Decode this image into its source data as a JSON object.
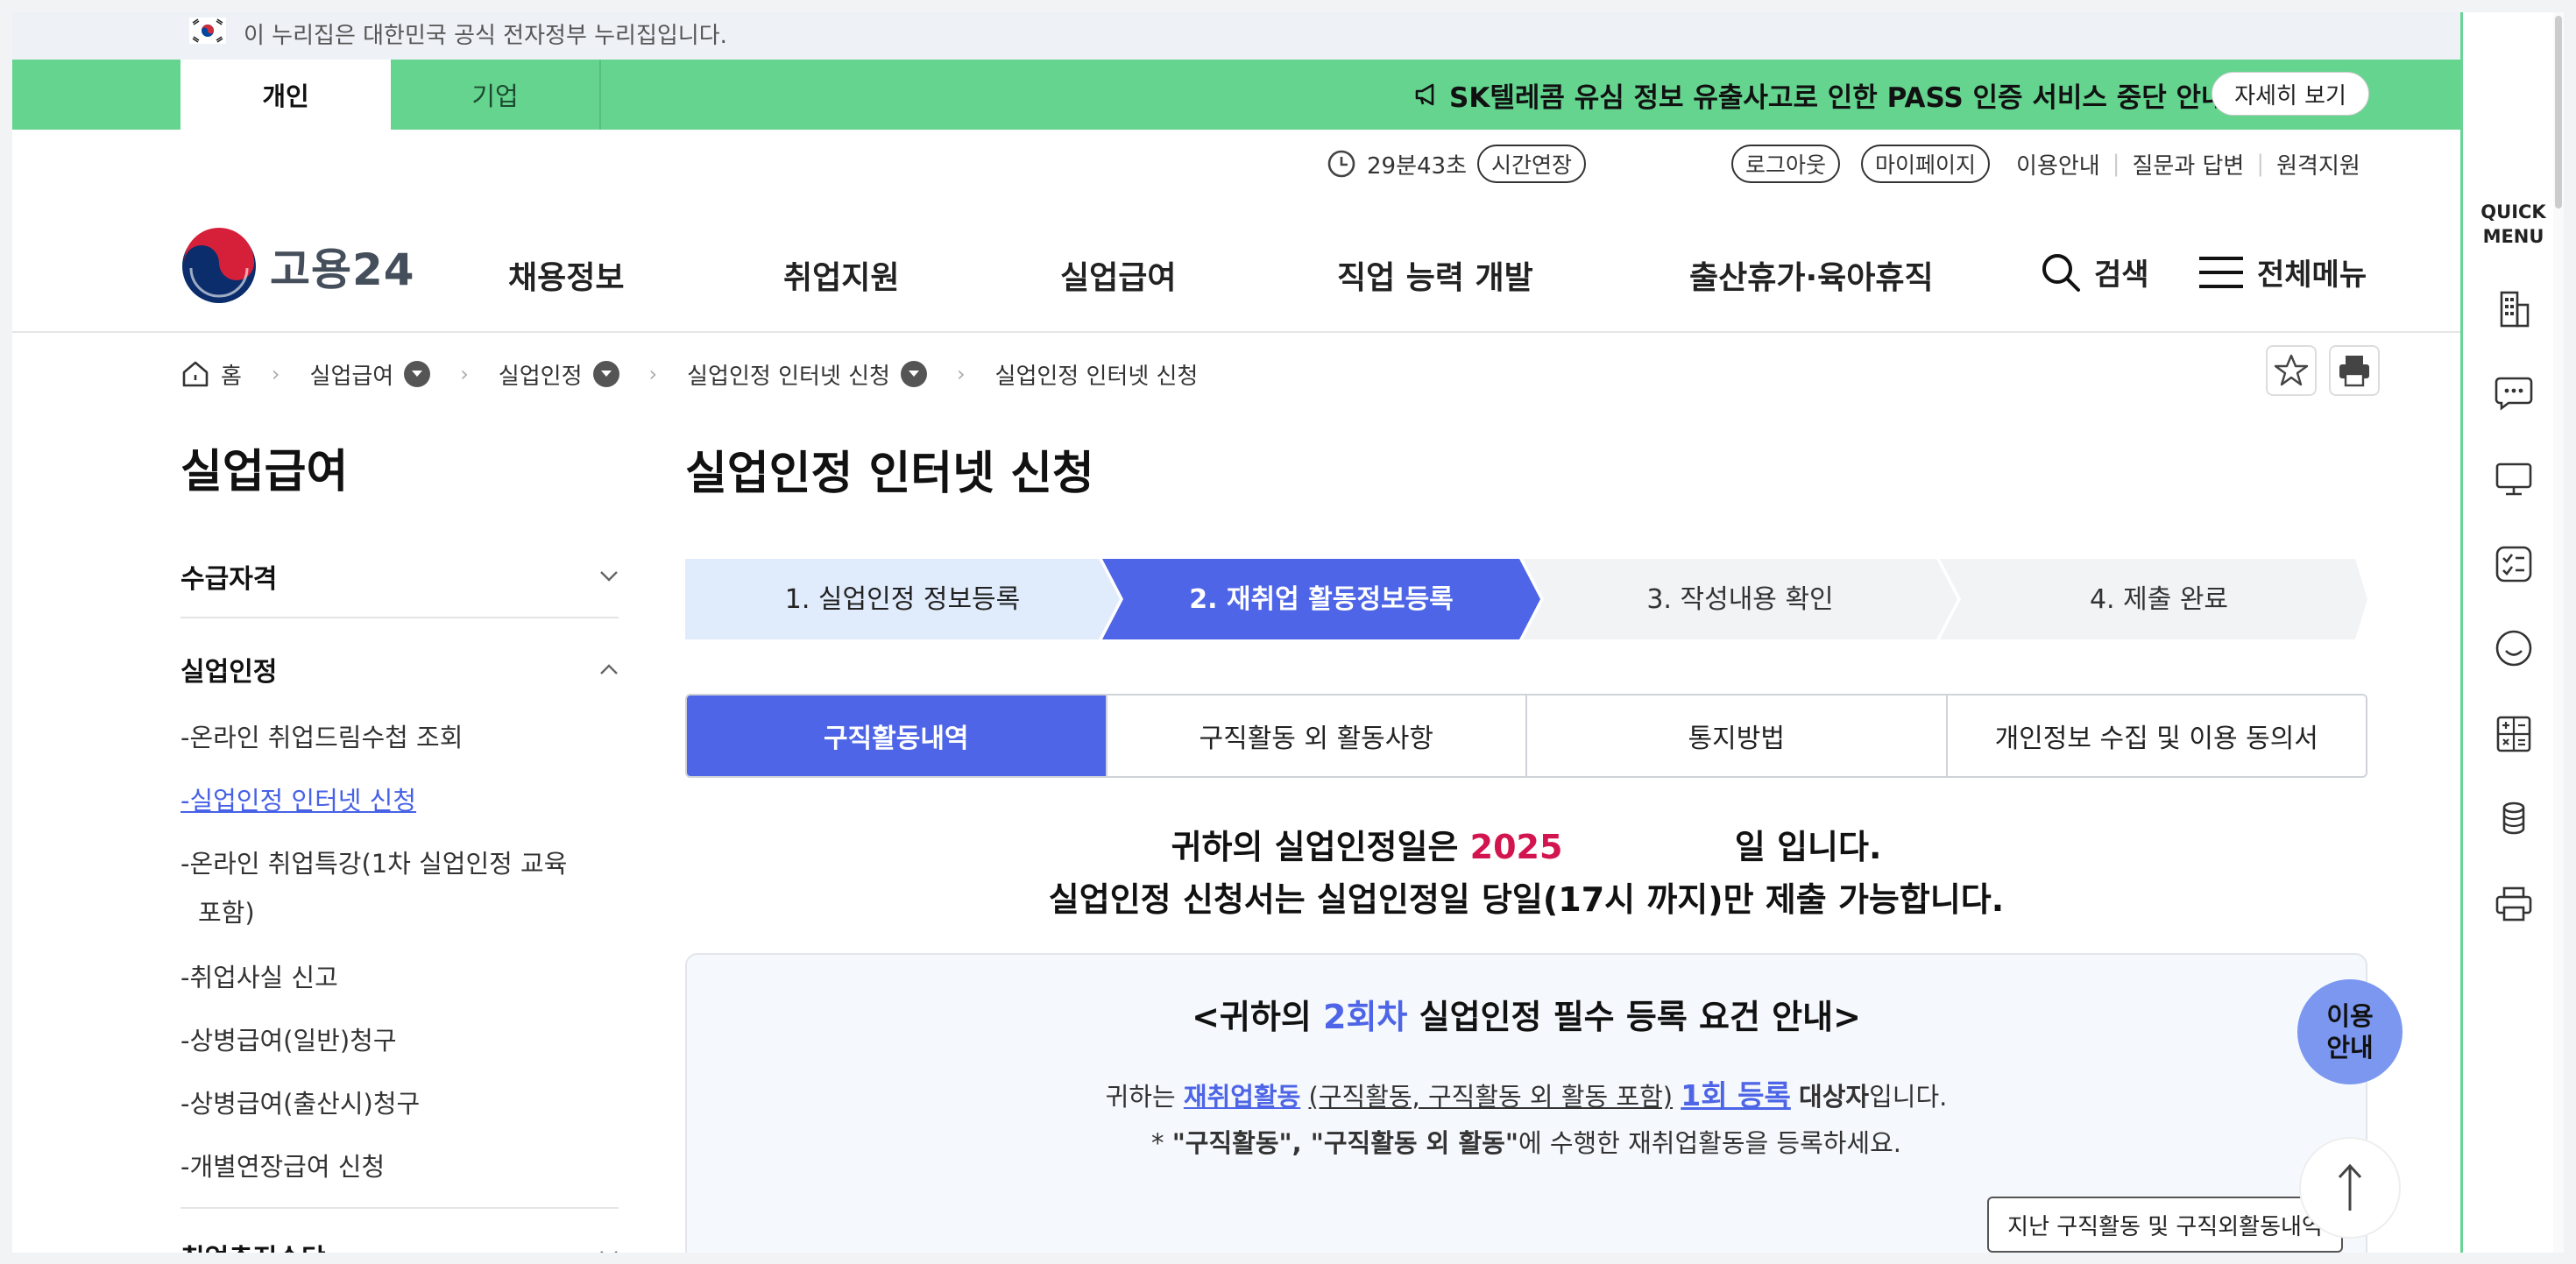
{
  "gov_banner": {
    "text": "이 누리집은 대한민국 공식 전자정부 누리집입니다."
  },
  "user_tabs": {
    "personal": "개인",
    "company": "기업"
  },
  "notice": {
    "text": "SK텔레콤 유심 정보 유출사고로 인한 PASS 인증 서비스 중단 안내",
    "button": "자세히 보기"
  },
  "session": {
    "time": "29분43초",
    "extend": "시간연장"
  },
  "utility": {
    "logout": "로그아웃",
    "mypage": "마이페이지",
    "guide": "이용안내",
    "qna": "질문과 답변",
    "remote": "원격지원"
  },
  "logo": {
    "text": "고용24"
  },
  "gnb": [
    "채용정보",
    "취업지원",
    "실업급여",
    "직업 능력 개발",
    "출산휴가·육아휴직"
  ],
  "header_actions": {
    "search": "검색",
    "all_menu": "전체메뉴"
  },
  "breadcrumb": [
    "홈",
    "실업급여",
    "실업인정",
    "실업인정 인터넷 신청",
    "실업인정 인터넷 신청"
  ],
  "lnb": {
    "title": "실업급여",
    "sections": [
      "수급자격",
      "실업인정",
      "취업촉진수당"
    ],
    "items": [
      "-온라인 취업드림수첩 조회",
      "-실업인정 인터넷 신청",
      "-온라인 취업특강(1차 실업인정 교육 포함)",
      "-취업사실 신고",
      "-상병급여(일반)청구",
      "-상병급여(출산시)청구",
      "-개별연장급여 신청"
    ]
  },
  "main": {
    "title": "실업인정 인터넷 신청",
    "steps": [
      "1. 실업인정 정보등록",
      "2. 재취업 활동정보등록",
      "3. 작성내용 확인",
      "4. 제출 완료"
    ],
    "active_step": 2,
    "tabs": [
      "구직활동내역",
      "구직활동 외 활동사항",
      "통지방법",
      "개인정보 수집 및 이용 동의서"
    ],
    "msg1_pre": "귀하의 실업인정일은",
    "msg1_year": "2025",
    "msg1_post": "일 입니다.",
    "msg2": "실업인정 신청서는 실업인정일 당일(17시 까지)만 제출 가능합니다.",
    "box_title_pre": "<귀하의",
    "box_title_round": "2회차",
    "box_title_post": "실업인정 필수 등록 요건 안내>",
    "box_p1_pre": "귀하는",
    "box_p1_link": "재취업활동",
    "box_p1_paren": "(구직활동, 구직활동 외 활동 포함)",
    "box_p1_count": "1회 등록",
    "box_p1_post_bold": "대상자",
    "box_p1_post": "입니다.",
    "box_p2_star": "*",
    "box_p2_bold": "\"구직활동\", \"구직활동 외 활동\"",
    "box_p2_rest": "에 수행한 재취업활동을 등록하세요.",
    "history_button": "지난 구직활동 및 구직외활동내역",
    "help_l1": "이용",
    "help_l2": "안내"
  },
  "quick_menu": {
    "title_l1": "QUICK",
    "title_l2": "MENU"
  },
  "colors": {
    "green": "#64d48f",
    "primary": "#4d65e6",
    "accent_red": "#d2154f"
  }
}
